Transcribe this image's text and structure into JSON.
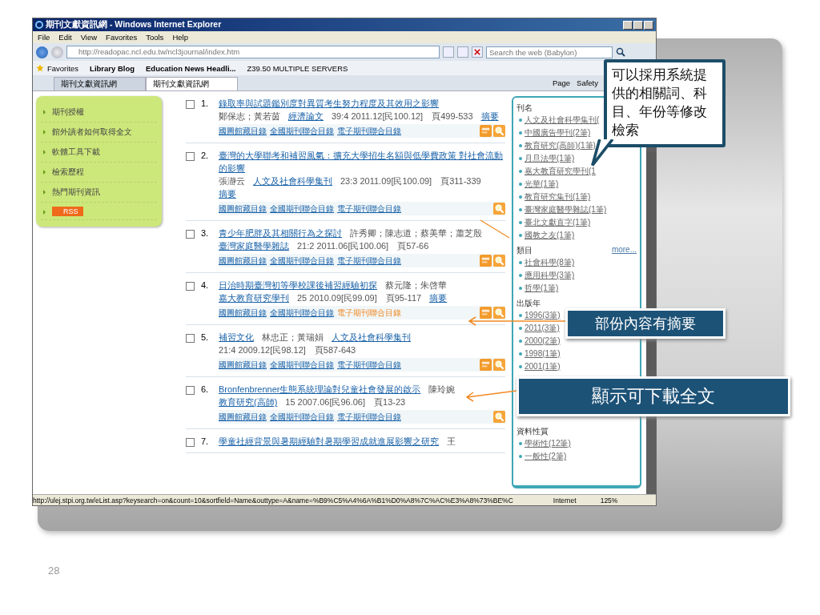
{
  "slide": {
    "page_number": "28"
  },
  "window": {
    "title": "期刊文獻資訊網 - Windows Internet Explorer"
  },
  "menu": [
    "File",
    "Edit",
    "View",
    "Favorites",
    "Tools",
    "Help"
  ],
  "address": {
    "url": "http://readopac.ncl.edu.tw/ncl3journal/index.htm",
    "search_placeholder": "Search the web (Babylon)"
  },
  "favorites_bar": {
    "label": "Favorites",
    "items": [
      "Library Blog",
      "Education News Headli...",
      "Z39.50 MULTIPLE SERVERS"
    ]
  },
  "tabs": [
    {
      "label": "期刊文獻資訊網",
      "selected": false
    },
    {
      "label": "期刊文獻資訊網",
      "selected": true
    }
  ],
  "command_bar": [
    "Page",
    "Safety"
  ],
  "sidebar": {
    "items": [
      "期刊授權",
      "館外讀者如何取得全文",
      "軟體工具下載",
      "檢索歷程",
      "熱門期刊資訊"
    ],
    "rss": "RSS"
  },
  "results": [
    {
      "number": "1.",
      "checked": false,
      "title": "錄取率與試題鑑別度對異質考生努力程度及其效用之影響",
      "authors": "鄭保志；黃若茵",
      "journal": "經濟論文",
      "details": "39:4 2011.12[民100.12]　頁499-533",
      "abstract": "摘要",
      "links": [
        {
          "label": "國圖館藏目錄",
          "highlighted": false
        },
        {
          "label": "全國期刊聯合目錄",
          "highlighted": false
        },
        {
          "label": "電子期刊聯合目錄",
          "highlighted": false
        }
      ],
      "pdf": true
    },
    {
      "number": "2.",
      "checked": false,
      "title": "臺灣的大學聯考和補習風氣：擴充大學招生名額與低學費政策 對社會流動的影響",
      "authors": "張瀞云",
      "journal": "人文及社會科學集刊",
      "details": "23:3 2011.09[民100.09]　頁311-339",
      "abstract": "摘要",
      "links": [
        {
          "label": "國圖館藏目錄",
          "highlighted": false
        },
        {
          "label": "全國期刊聯合目錄",
          "highlighted": false
        },
        {
          "label": "電子期刊聯合目錄",
          "highlighted": false
        }
      ],
      "pdf": false
    },
    {
      "number": "3.",
      "checked": false,
      "title": "青少年肥胖及其相關行為之探討",
      "authors": "許秀卿；陳志道；蔡美華；蕭芝殷",
      "journal": "臺灣家庭醫學雜誌",
      "details": "21:2 2011.06[民100.06]　頁57-66",
      "links": [
        {
          "label": "國圖館藏目錄",
          "highlighted": false
        },
        {
          "label": "全國期刊聯合目錄",
          "highlighted": false
        },
        {
          "label": "電子期刊聯合目錄",
          "highlighted": false
        }
      ],
      "pdf": true
    },
    {
      "number": "4.",
      "checked": false,
      "title": "日治時期臺灣初等學校課後補習經驗初探",
      "authors": "蔡元隆；朱啓華",
      "journal": "嘉大教育研究學刊",
      "details": "25 2010.09[民99.09]　頁95-117",
      "abstract": "摘要",
      "links": [
        {
          "label": "國圖館藏目錄",
          "highlighted": false
        },
        {
          "label": "全國期刊聯合目錄",
          "highlighted": false
        },
        {
          "label": "電子期刊聯合目錄",
          "highlighted": true
        }
      ],
      "pdf": true
    },
    {
      "number": "5.",
      "checked": false,
      "title": "補習文化",
      "authors": "林忠正；黃瑞娟",
      "journal": "人文及社會科學集刊",
      "details": "21:4 2009.12[民98.12]　頁587-643",
      "links": [
        {
          "label": "國圖館藏目錄",
          "highlighted": false
        },
        {
          "label": "全國期刊聯合目錄",
          "highlighted": false
        },
        {
          "label": "電子期刊聯合目錄",
          "highlighted": false
        }
      ],
      "pdf": true
    },
    {
      "number": "6.",
      "checked": false,
      "title": "Bronfenbrenner生態系統理論對兒童社會發展的啟示",
      "authors": "陳玲婉",
      "journal": "教育研究(高師)",
      "details": "15 2007.06[民96.06]　頁13-23",
      "links": [
        {
          "label": "國圖館藏目錄",
          "highlighted": false
        },
        {
          "label": "全國期刊聯合目錄",
          "highlighted": false
        },
        {
          "label": "電子期刊聯合目錄",
          "highlighted": false
        }
      ],
      "pdf": false
    },
    {
      "number": "7.",
      "checked": false,
      "title": "學童社經背景與暑期經驗對暑期學習成就進展影響之研究",
      "authors": "王"
    }
  ],
  "facets": [
    {
      "heading": "刊名",
      "items": [
        "人文及社會科學集刊(",
        "中國廣告學刊(2筆)",
        "教育研究(高師)(1筆)",
        "月旦法學(1筆)",
        "嘉大教育研究學刊(1",
        "光華(1筆)",
        "教育研究集刊(1筆)",
        "臺灣家庭醫學雜誌(1筆)",
        "臺北文獻直字(1筆)",
        "國教之友(1筆)"
      ]
    },
    {
      "heading": "類目",
      "more": "more...",
      "items": [
        "社會科學(8筆)",
        "應用科學(3筆)",
        "哲學(1筆)"
      ]
    },
    {
      "heading": "出版年",
      "items": [
        "1996(3筆)",
        "2011(3筆)",
        "2000(2筆)",
        "1998(1筆)",
        "2001(1筆)"
      ]
    },
    {
      "heading": "資料性質",
      "items": [
        "學術性(12筆)",
        "一般性(2筆)"
      ]
    }
  ],
  "status_bar": {
    "url": "http://ulej.stpi.org.tw/eList.asp?keysearch=on&count=10&sortfield=Name&outtype=A&name=%B9%C5%A4%6A%B1%D0%A8%7C%AC%E3%A8%73%BE%C",
    "zone": "Internet",
    "zoom": "125%"
  },
  "callouts": [
    {
      "kind": "balloon",
      "text": "可以採用系統提供的相關詞、科目、年份等修改檢索"
    },
    {
      "kind": "banner",
      "text": "部份內容有摘要"
    },
    {
      "kind": "banner-large",
      "text": "顯示可下載全文"
    }
  ]
}
